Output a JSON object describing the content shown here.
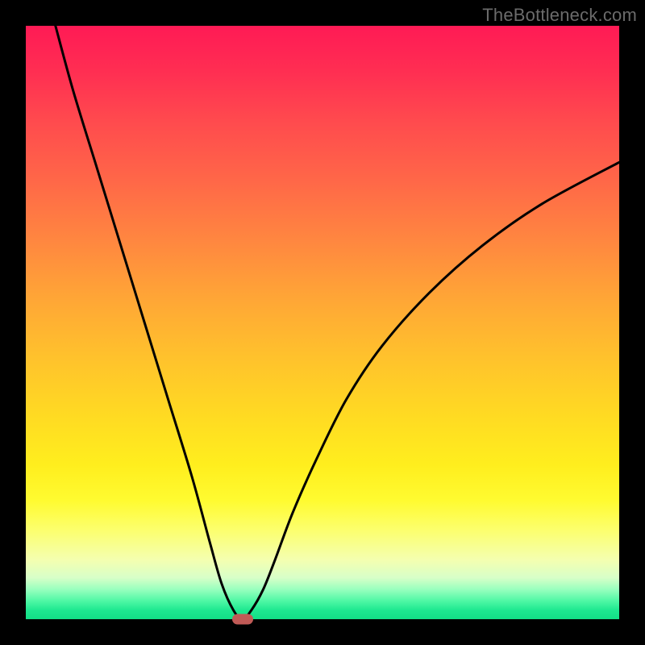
{
  "watermark": "TheBottleneck.com",
  "chart_data": {
    "type": "line",
    "title": "",
    "xlabel": "",
    "ylabel": "",
    "xlim": [
      0,
      100
    ],
    "ylim": [
      0,
      100
    ],
    "legend": false,
    "grid": false,
    "background": {
      "direction": "top-to-bottom",
      "stops": [
        {
          "pos": 0.0,
          "color": "#ff1a55"
        },
        {
          "pos": 0.26,
          "color": "#ff6748"
        },
        {
          "pos": 0.56,
          "color": "#ffc22c"
        },
        {
          "pos": 0.8,
          "color": "#fffb30"
        },
        {
          "pos": 0.93,
          "color": "#d8ffc8"
        },
        {
          "pos": 1.0,
          "color": "#12df86"
        }
      ]
    },
    "series": [
      {
        "name": "bottleneck-curve",
        "color": "#000000",
        "x": [
          5,
          8,
          12,
          16,
          20,
          24,
          28,
          31,
          33,
          35,
          36.5,
          38,
          40,
          42,
          45,
          49,
          54,
          60,
          68,
          77,
          87,
          100
        ],
        "y": [
          100,
          89,
          76,
          63,
          50,
          37,
          24,
          13,
          6,
          1.5,
          0,
          1.5,
          5,
          10,
          18,
          27,
          37,
          46,
          55,
          63,
          70,
          77
        ]
      }
    ],
    "markers": [
      {
        "name": "min-point",
        "x": 36.5,
        "y": 0,
        "color": "#c05a56",
        "shape": "rounded-rect"
      }
    ]
  }
}
